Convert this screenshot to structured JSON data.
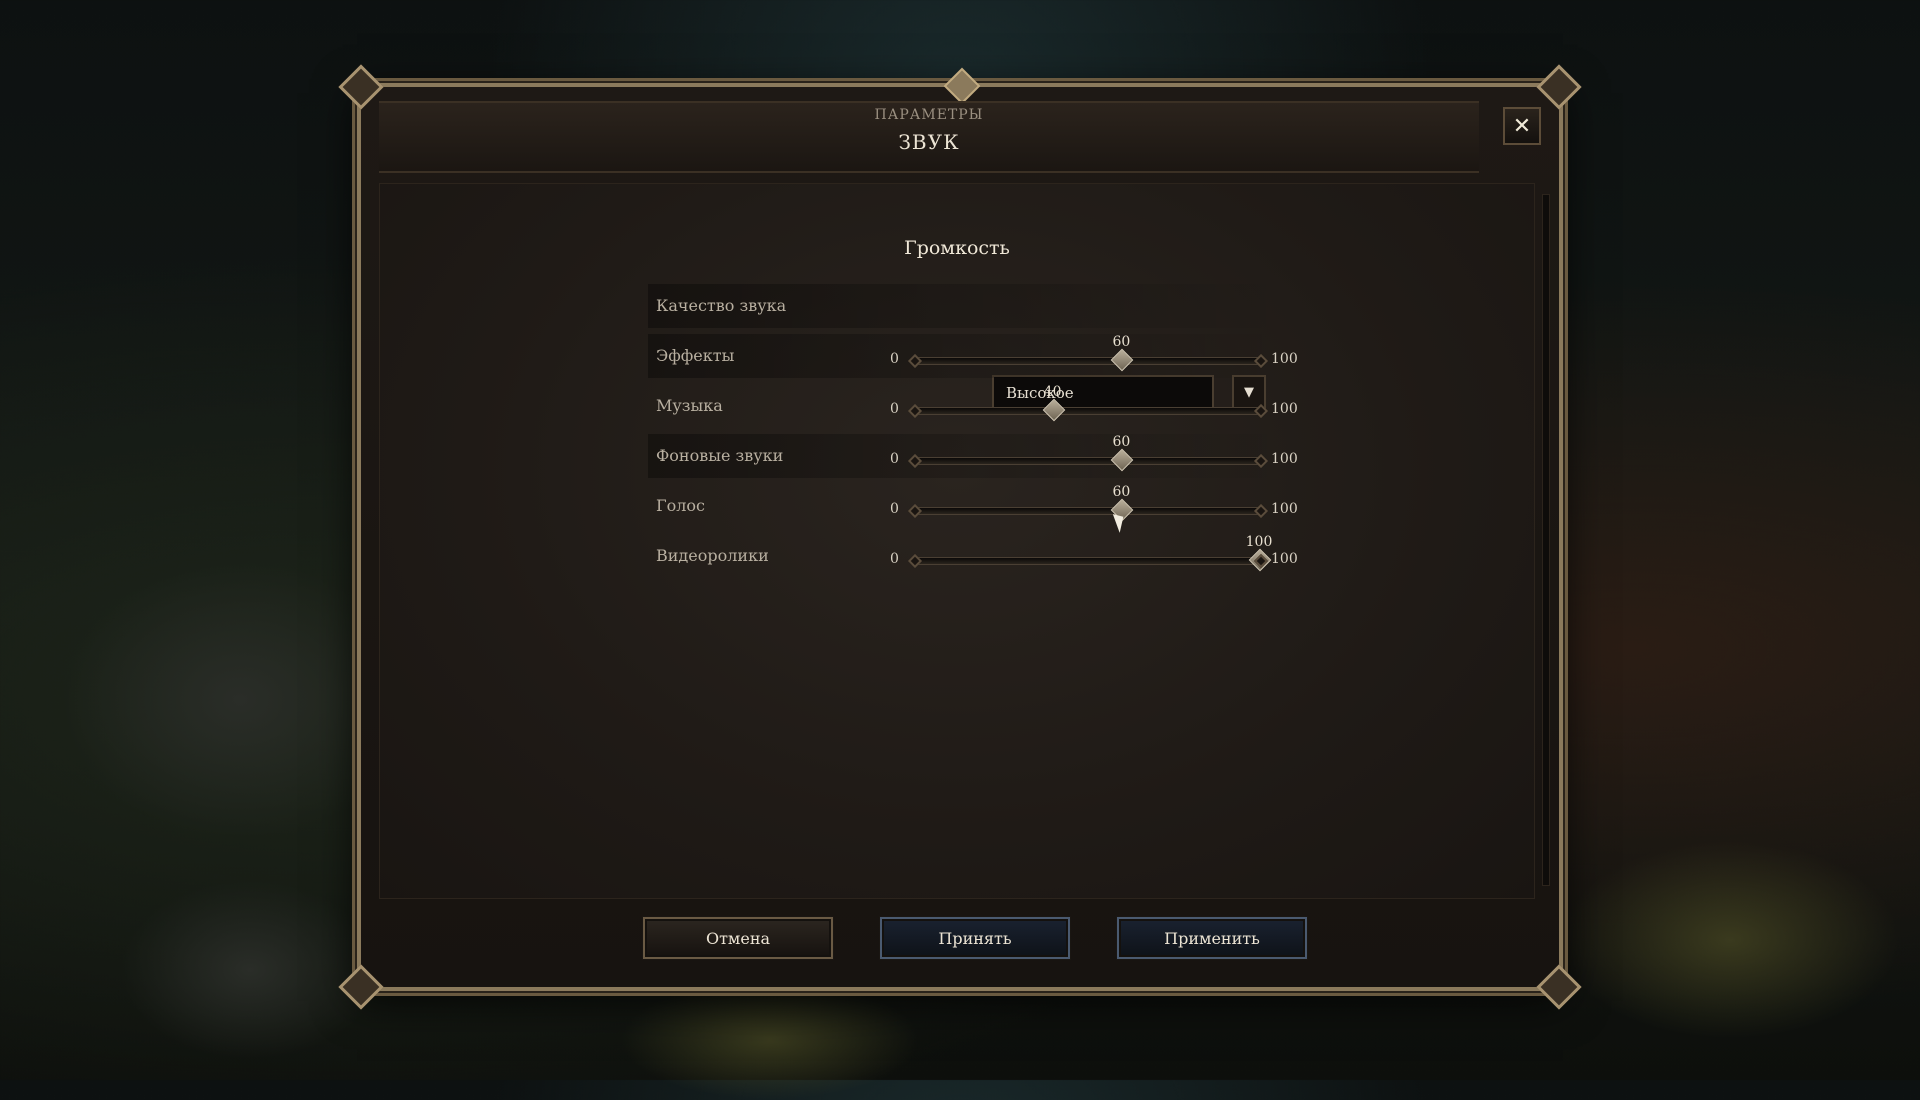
{
  "dialog": {
    "subtitle": "ПАРАМЕТРЫ",
    "title": "ЗВУК",
    "close_icon": "close-icon"
  },
  "volume": {
    "section_title": "Громкость",
    "quality": {
      "label": "Качество звука",
      "value": "Высокое",
      "arrow_icon": "chevron-down-icon"
    },
    "sliders": [
      {
        "label": "Эффекты",
        "min": "0",
        "max": "100",
        "value": "60"
      },
      {
        "label": "Музыка",
        "min": "0",
        "max": "100",
        "value": "40"
      },
      {
        "label": "Фоновые звуки",
        "min": "0",
        "max": "100",
        "value": "60"
      },
      {
        "label": "Голос",
        "min": "0",
        "max": "100",
        "value": "60"
      },
      {
        "label": "Видеоролики",
        "min": "0",
        "max": "100",
        "value": "100"
      }
    ]
  },
  "footer": {
    "cancel_label": "Отмена",
    "accept_label": "Принять",
    "apply_label": "Применить"
  },
  "colors": {
    "frame": "#8b7a5c",
    "panel": "#1f1a16",
    "text": "#e8e0d0"
  }
}
